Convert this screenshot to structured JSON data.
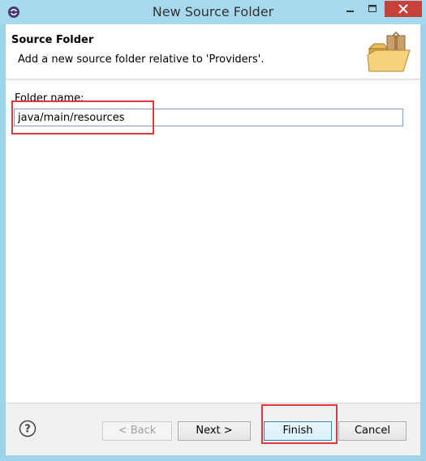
{
  "window": {
    "title": "New Source Folder",
    "close_color": "#c7403a"
  },
  "header": {
    "title": "Source Folder",
    "description": "Add a new source folder relative to 'Providers'.",
    "icon": "folder-with-package-icon"
  },
  "form": {
    "folder_name_label": "Folder name:",
    "folder_name_value": "java/main/resources"
  },
  "footer": {
    "help_icon": "help-icon",
    "back_label": "< Back",
    "next_label": "Next >",
    "finish_label": "Finish",
    "cancel_label": "Cancel"
  },
  "annotations": {
    "highlight_color": "#e0393a"
  }
}
